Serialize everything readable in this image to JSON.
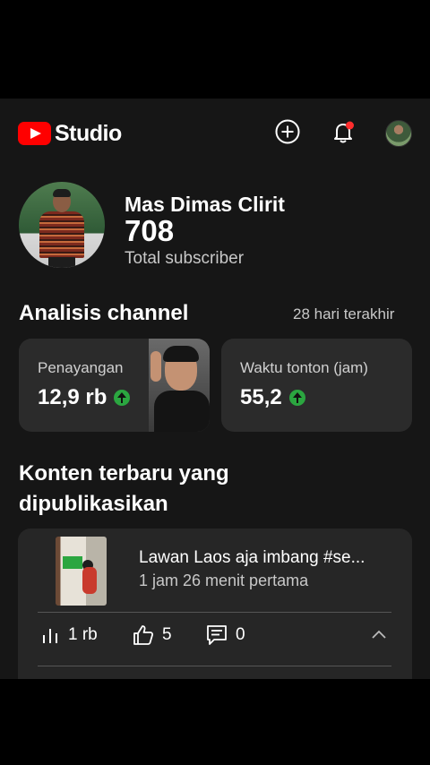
{
  "header": {
    "logo_text": "Studio",
    "icons": [
      "youtube-logo-icon",
      "create-plus-icon",
      "notification-bell-icon",
      "account-avatar"
    ],
    "accent_color": "#ff0000",
    "notification_dot_color": "#ff2d2d"
  },
  "channel": {
    "name": "Mas Dimas Clirit",
    "subscribers": "708",
    "subscribers_label": "Total subscriber"
  },
  "analytics": {
    "title": "Analisis channel",
    "period": "28 hari terakhir",
    "cards": [
      {
        "label": "Penayangan",
        "value": "12,9 rb",
        "trend": "up"
      },
      {
        "label": "Waktu tonton (jam)",
        "value": "55,2",
        "trend": "up"
      }
    ],
    "trend_color": "#2ba640"
  },
  "latest": {
    "title_line1": "Konten terbaru yang",
    "title_line2": "dipublikasikan",
    "video": {
      "title": "Lawan Laos aja imbang #se...",
      "time": "1 jam 26 menit pertama",
      "views": "1 rb",
      "likes": "5",
      "comments": "0"
    }
  }
}
